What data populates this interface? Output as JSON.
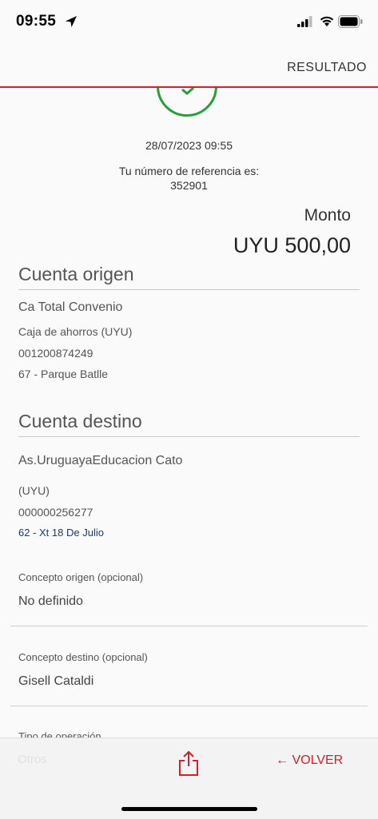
{
  "status_bar": {
    "time": "09:55"
  },
  "header": {
    "title": "RESULTADO"
  },
  "receipt": {
    "datetime": "28/07/2023 09:55",
    "reference_label": "Tu número de referencia es:",
    "reference_number": "352901",
    "amount_label": "Monto",
    "amount_value": "UYU 500,00"
  },
  "origin_account": {
    "title": "Cuenta origen",
    "name": "Ca Total Convenio",
    "type": "Caja de ahorros (UYU)",
    "number": "001200874249",
    "branch": "67 - Parque Batlle"
  },
  "destination_account": {
    "title": "Cuenta destino",
    "name": "As.UruguayaEducacion Cato",
    "currency": "(UYU)",
    "number": "000000256277",
    "branch": "62 - Xt 18 De Julio"
  },
  "concepts": {
    "origin_label": "Concepto origen (opcional)",
    "origin_value": "No definido",
    "destination_label": "Concepto destino (opcional)",
    "destination_value": "Gisell Cataldi",
    "operation_type_label": "Tipo de operación"
  },
  "bottom_bar": {
    "back_label": "← VOLVER",
    "faded_text": "Otros"
  },
  "colors": {
    "accent": "#d0202a",
    "success": "#2a9d3a",
    "link_blue": "#1d3a6e"
  }
}
